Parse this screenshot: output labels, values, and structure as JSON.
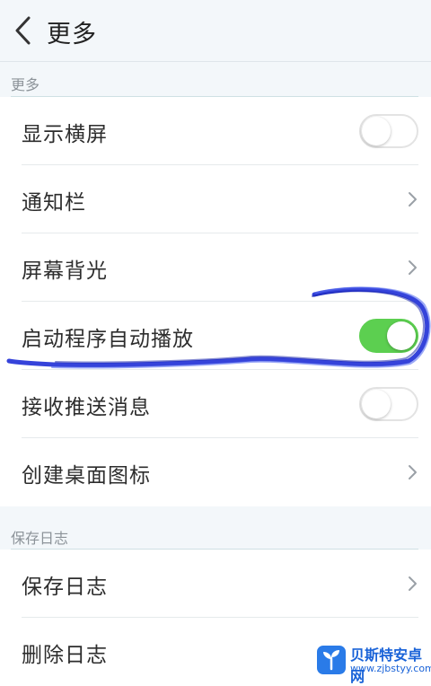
{
  "header": {
    "title": "更多",
    "back_icon": "chevron-left-icon"
  },
  "sections": [
    {
      "label": "更多"
    },
    {
      "label": "保存日志"
    }
  ],
  "rows": [
    {
      "label": "显示横屏",
      "control": "toggle",
      "on": false
    },
    {
      "label": "通知栏",
      "control": "chevron"
    },
    {
      "label": "屏幕背光",
      "control": "chevron"
    },
    {
      "label": "启动程序自动播放",
      "control": "toggle",
      "on": true
    },
    {
      "label": "接收推送消息",
      "control": "toggle",
      "on": false
    },
    {
      "label": "创建桌面图标",
      "control": "chevron"
    },
    {
      "label": "保存日志",
      "control": "chevron"
    },
    {
      "label": "删除日志",
      "control": "chevron"
    }
  ],
  "colors": {
    "accent_on": "#5ccf50",
    "annotation": "#1f2fd6",
    "header_bg": "#f3f7fa"
  },
  "watermark": {
    "title": "贝斯特安卓网",
    "url": "www.zjbstyy.com",
    "icon": "sprout-icon"
  }
}
